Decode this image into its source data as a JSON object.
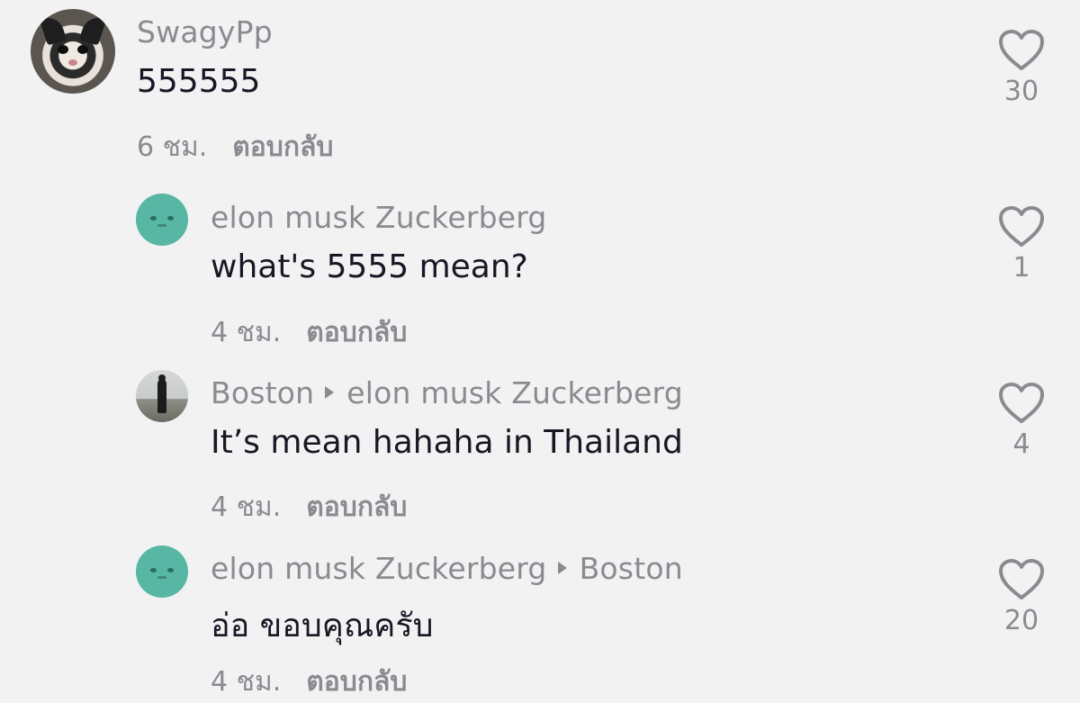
{
  "comments": [
    {
      "username": "SwagyPp",
      "reply_to": "",
      "text": "555555",
      "time": "6 ชม.",
      "reply_label": "ตอบกลับ",
      "likes": "30",
      "avatar_icon": "cat-avatar"
    },
    {
      "username": "elon musk Zuckerberg",
      "reply_to": "",
      "text": "what's 5555 mean?",
      "time": "4 ชม.",
      "reply_label": "ตอบกลับ",
      "likes": "1",
      "avatar_icon": "blob-avatar"
    },
    {
      "username": "Boston",
      "reply_to": "elon musk Zuckerberg",
      "text": "It’s mean hahaha in Thailand",
      "time": "4 ชม.",
      "reply_label": "ตอบกลับ",
      "likes": "4",
      "avatar_icon": "photo-avatar"
    },
    {
      "username": "elon musk Zuckerberg",
      "reply_to": "Boston",
      "text": "อ่อ ขอบคุณครับ",
      "time": "4 ชม.",
      "reply_label": "ตอบกลับ",
      "likes": "20",
      "avatar_icon": "blob-avatar"
    }
  ],
  "colors": {
    "background": "#f2f2f3",
    "text": "#161823",
    "secondary": "#8a8b91",
    "avatar_teal": "#57b6a4"
  }
}
